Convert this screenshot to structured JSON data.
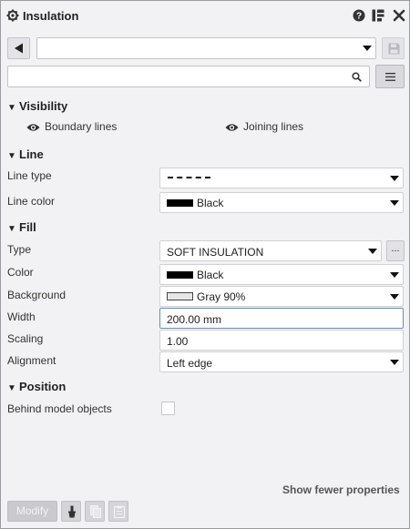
{
  "window": {
    "title": "Insulation",
    "icons": [
      "gear-icon",
      "help-icon",
      "layout-icon",
      "close-icon"
    ]
  },
  "toolbar": {
    "preset_value": "",
    "search_value": ""
  },
  "sections": {
    "visibility": "Visibility",
    "line": "Line",
    "fill": "Fill",
    "position": "Position"
  },
  "visibility": {
    "boundary_lines": "Boundary lines",
    "joining_lines": "Joining lines"
  },
  "line": {
    "type_label": "Line type",
    "color_label": "Line color",
    "color_value": "Black",
    "color_swatch": "#000000"
  },
  "fill": {
    "type_label": "Type",
    "type_value": "SOFT INSULATION",
    "color_label": "Color",
    "color_value": "Black",
    "color_swatch": "#000000",
    "background_label": "Background",
    "background_value": "Gray 90%",
    "background_swatch": "#e6e6e6",
    "width_label": "Width",
    "width_value": "200.00 mm",
    "scaling_label": "Scaling",
    "scaling_value": "1.00",
    "alignment_label": "Alignment",
    "alignment_value": "Left edge",
    "ellipsis": "..."
  },
  "position": {
    "behind_label": "Behind model objects",
    "behind_checked": false
  },
  "footer": {
    "show_fewer": "Show fewer properties",
    "modify": "Modify"
  },
  "colors": {
    "panel_bg": "#f2f2f4",
    "focus_border": "#5f8fbf"
  }
}
